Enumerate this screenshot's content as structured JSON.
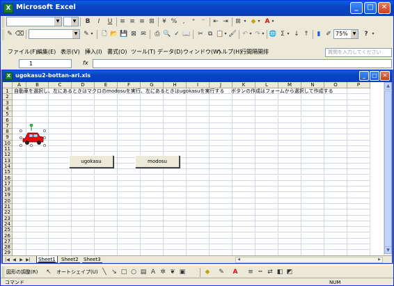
{
  "window": {
    "title": "Microsoft Excel",
    "minimize": "_",
    "restore": "□",
    "close": "✕"
  },
  "toolbar1": {
    "font_name": "",
    "font_size": "",
    "bold": "B",
    "italic": "I",
    "underline": "U",
    "percent": "%",
    "comma": ",",
    "fill_color_arrow": "▾",
    "font_color_arrow": "▾"
  },
  "toolbar2": {
    "line_style_value": "",
    "zoom": "75%",
    "help_icon": "?"
  },
  "menu": {
    "items": [
      "ファイル(F)",
      "編集(E)",
      "表示(V)",
      "挿入(I)",
      "書式(O)",
      "ツール(T)",
      "データ(D)",
      "ウィンドウ(W)",
      "ヘルプ(H)",
      "行間隔開排"
    ],
    "help_placeholder": "質問を入力してください"
  },
  "formula_bar": {
    "name_box": "1",
    "fx": "fx",
    "value": ""
  },
  "workbook": {
    "title": "ugokasu2-bottan-ari.xls",
    "columns": [
      "A",
      "B",
      "C",
      "D",
      "E",
      "F",
      "G",
      "H",
      "I",
      "J",
      "K",
      "L",
      "M",
      "N",
      "O",
      "P"
    ],
    "rows": [
      "1",
      "2",
      "3",
      "4",
      "5",
      "6",
      "7",
      "8",
      "9",
      "10",
      "11",
      "12",
      "13",
      "14",
      "15",
      "16",
      "17",
      "18",
      "19",
      "20",
      "21",
      "22",
      "23",
      "24",
      "25",
      "26",
      "27",
      "28",
      "29"
    ],
    "cells": {
      "A1": "自動車を選択し、左にあるときはマクロのmodosuを実行、左にあるときはugokasuを実行する",
      "J1": "ボタンの作成はフォームから選択して作成する"
    },
    "buttons": [
      {
        "label": "ugokasu"
      },
      {
        "label": "modosu"
      }
    ],
    "sheets": [
      "Sheet1",
      "Sheet2",
      "Sheet3"
    ]
  },
  "drawing_toolbar": {
    "draw_label": "図形の調整(R)",
    "autoshape_label": "オートシェイプ(U)"
  },
  "status": {
    "left": "コマンド",
    "num": "NUM"
  },
  "colors": {
    "titlebar": "#0844c4",
    "chrome": "#ece9d8",
    "car_body": "#e01010"
  }
}
